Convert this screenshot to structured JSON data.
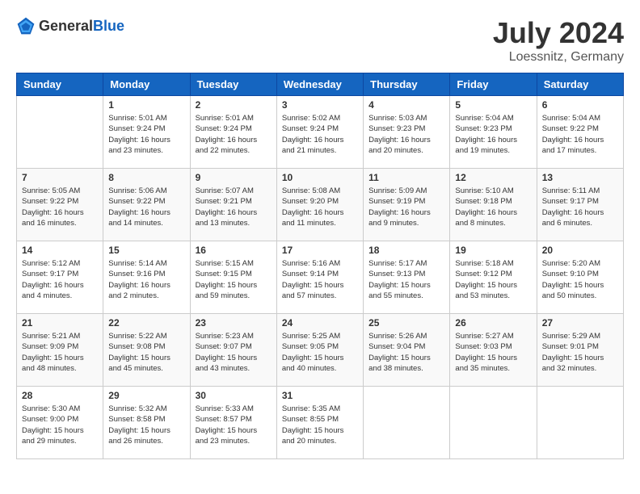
{
  "header": {
    "logo_general": "General",
    "logo_blue": "Blue",
    "month_title": "July 2024",
    "location": "Loessnitz, Germany"
  },
  "weekdays": [
    "Sunday",
    "Monday",
    "Tuesday",
    "Wednesday",
    "Thursday",
    "Friday",
    "Saturday"
  ],
  "weeks": [
    [
      {
        "day": "",
        "sunrise": "",
        "sunset": "",
        "daylight": ""
      },
      {
        "day": "1",
        "sunrise": "Sunrise: 5:01 AM",
        "sunset": "Sunset: 9:24 PM",
        "daylight": "Daylight: 16 hours and 23 minutes."
      },
      {
        "day": "2",
        "sunrise": "Sunrise: 5:01 AM",
        "sunset": "Sunset: 9:24 PM",
        "daylight": "Daylight: 16 hours and 22 minutes."
      },
      {
        "day": "3",
        "sunrise": "Sunrise: 5:02 AM",
        "sunset": "Sunset: 9:24 PM",
        "daylight": "Daylight: 16 hours and 21 minutes."
      },
      {
        "day": "4",
        "sunrise": "Sunrise: 5:03 AM",
        "sunset": "Sunset: 9:23 PM",
        "daylight": "Daylight: 16 hours and 20 minutes."
      },
      {
        "day": "5",
        "sunrise": "Sunrise: 5:04 AM",
        "sunset": "Sunset: 9:23 PM",
        "daylight": "Daylight: 16 hours and 19 minutes."
      },
      {
        "day": "6",
        "sunrise": "Sunrise: 5:04 AM",
        "sunset": "Sunset: 9:22 PM",
        "daylight": "Daylight: 16 hours and 17 minutes."
      }
    ],
    [
      {
        "day": "7",
        "sunrise": "Sunrise: 5:05 AM",
        "sunset": "Sunset: 9:22 PM",
        "daylight": "Daylight: 16 hours and 16 minutes."
      },
      {
        "day": "8",
        "sunrise": "Sunrise: 5:06 AM",
        "sunset": "Sunset: 9:22 PM",
        "daylight": "Daylight: 16 hours and 14 minutes."
      },
      {
        "day": "9",
        "sunrise": "Sunrise: 5:07 AM",
        "sunset": "Sunset: 9:21 PM",
        "daylight": "Daylight: 16 hours and 13 minutes."
      },
      {
        "day": "10",
        "sunrise": "Sunrise: 5:08 AM",
        "sunset": "Sunset: 9:20 PM",
        "daylight": "Daylight: 16 hours and 11 minutes."
      },
      {
        "day": "11",
        "sunrise": "Sunrise: 5:09 AM",
        "sunset": "Sunset: 9:19 PM",
        "daylight": "Daylight: 16 hours and 9 minutes."
      },
      {
        "day": "12",
        "sunrise": "Sunrise: 5:10 AM",
        "sunset": "Sunset: 9:18 PM",
        "daylight": "Daylight: 16 hours and 8 minutes."
      },
      {
        "day": "13",
        "sunrise": "Sunrise: 5:11 AM",
        "sunset": "Sunset: 9:17 PM",
        "daylight": "Daylight: 16 hours and 6 minutes."
      }
    ],
    [
      {
        "day": "14",
        "sunrise": "Sunrise: 5:12 AM",
        "sunset": "Sunset: 9:17 PM",
        "daylight": "Daylight: 16 hours and 4 minutes."
      },
      {
        "day": "15",
        "sunrise": "Sunrise: 5:14 AM",
        "sunset": "Sunset: 9:16 PM",
        "daylight": "Daylight: 16 hours and 2 minutes."
      },
      {
        "day": "16",
        "sunrise": "Sunrise: 5:15 AM",
        "sunset": "Sunset: 9:15 PM",
        "daylight": "Daylight: 15 hours and 59 minutes."
      },
      {
        "day": "17",
        "sunrise": "Sunrise: 5:16 AM",
        "sunset": "Sunset: 9:14 PM",
        "daylight": "Daylight: 15 hours and 57 minutes."
      },
      {
        "day": "18",
        "sunrise": "Sunrise: 5:17 AM",
        "sunset": "Sunset: 9:13 PM",
        "daylight": "Daylight: 15 hours and 55 minutes."
      },
      {
        "day": "19",
        "sunrise": "Sunrise: 5:18 AM",
        "sunset": "Sunset: 9:12 PM",
        "daylight": "Daylight: 15 hours and 53 minutes."
      },
      {
        "day": "20",
        "sunrise": "Sunrise: 5:20 AM",
        "sunset": "Sunset: 9:10 PM",
        "daylight": "Daylight: 15 hours and 50 minutes."
      }
    ],
    [
      {
        "day": "21",
        "sunrise": "Sunrise: 5:21 AM",
        "sunset": "Sunset: 9:09 PM",
        "daylight": "Daylight: 15 hours and 48 minutes."
      },
      {
        "day": "22",
        "sunrise": "Sunrise: 5:22 AM",
        "sunset": "Sunset: 9:08 PM",
        "daylight": "Daylight: 15 hours and 45 minutes."
      },
      {
        "day": "23",
        "sunrise": "Sunrise: 5:23 AM",
        "sunset": "Sunset: 9:07 PM",
        "daylight": "Daylight: 15 hours and 43 minutes."
      },
      {
        "day": "24",
        "sunrise": "Sunrise: 5:25 AM",
        "sunset": "Sunset: 9:05 PM",
        "daylight": "Daylight: 15 hours and 40 minutes."
      },
      {
        "day": "25",
        "sunrise": "Sunrise: 5:26 AM",
        "sunset": "Sunset: 9:04 PM",
        "daylight": "Daylight: 15 hours and 38 minutes."
      },
      {
        "day": "26",
        "sunrise": "Sunrise: 5:27 AM",
        "sunset": "Sunset: 9:03 PM",
        "daylight": "Daylight: 15 hours and 35 minutes."
      },
      {
        "day": "27",
        "sunrise": "Sunrise: 5:29 AM",
        "sunset": "Sunset: 9:01 PM",
        "daylight": "Daylight: 15 hours and 32 minutes."
      }
    ],
    [
      {
        "day": "28",
        "sunrise": "Sunrise: 5:30 AM",
        "sunset": "Sunset: 9:00 PM",
        "daylight": "Daylight: 15 hours and 29 minutes."
      },
      {
        "day": "29",
        "sunrise": "Sunrise: 5:32 AM",
        "sunset": "Sunset: 8:58 PM",
        "daylight": "Daylight: 15 hours and 26 minutes."
      },
      {
        "day": "30",
        "sunrise": "Sunrise: 5:33 AM",
        "sunset": "Sunset: 8:57 PM",
        "daylight": "Daylight: 15 hours and 23 minutes."
      },
      {
        "day": "31",
        "sunrise": "Sunrise: 5:35 AM",
        "sunset": "Sunset: 8:55 PM",
        "daylight": "Daylight: 15 hours and 20 minutes."
      },
      {
        "day": "",
        "sunrise": "",
        "sunset": "",
        "daylight": ""
      },
      {
        "day": "",
        "sunrise": "",
        "sunset": "",
        "daylight": ""
      },
      {
        "day": "",
        "sunrise": "",
        "sunset": "",
        "daylight": ""
      }
    ]
  ]
}
